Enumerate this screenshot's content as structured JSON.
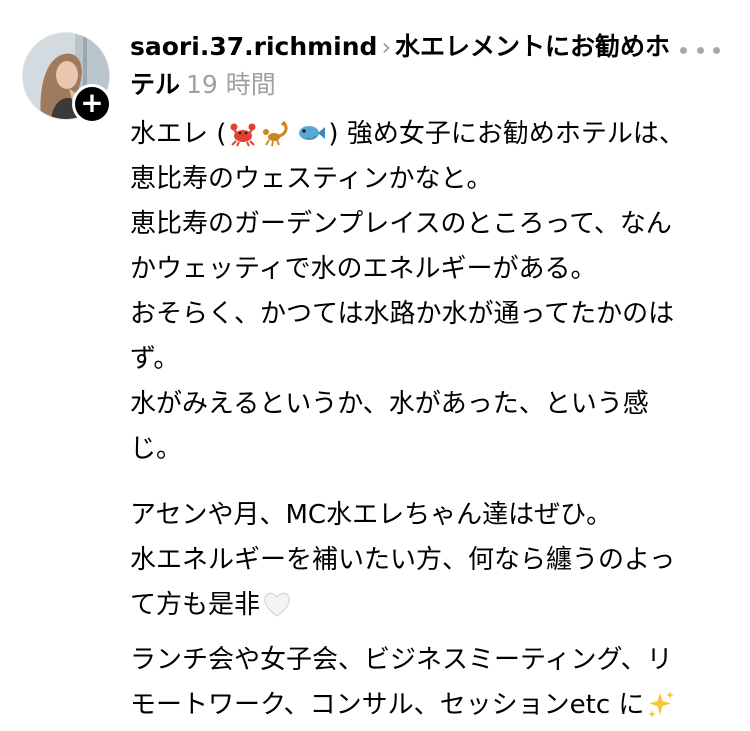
{
  "post": {
    "username": "saori.37.richmind",
    "topic": "水エレメントにお勧めホテル",
    "time": "19 時間",
    "body": {
      "line1_pre": "水エレ (",
      "line1_post": ") 強め女子にお勧めホテルは、",
      "line2": "恵比寿のウェスティンかなと。",
      "line3": "恵比寿のガーデンプレイスのところって、なん",
      "line4": "かウェッティで水のエネルギーがある。",
      "line5": "おそらく、かつては水路か水が通ってたかのは",
      "line6": "ず。",
      "line7": "水がみえるというか、水があった、という感",
      "line8": "じ。",
      "line9": "アセンや月、MC水エレちゃん達はぜひ。",
      "line10": "水エネルギーを補いたい方、何なら纏うのよっ",
      "line11_pre": "て方も是非",
      "line12": "ランチ会や女子会、ビジネスミーティング、リ",
      "line13_pre": "モートワーク、コンサル、セッションetc に"
    },
    "icons": {
      "follow": "plus-icon",
      "more": "more-options-icon",
      "crab": "crab-emoji",
      "scorpion": "scorpion-emoji",
      "fish": "fish-emoji",
      "heart": "white-heart-emoji",
      "sparkles": "sparkles-emoji"
    },
    "colors": {
      "text": "#000000",
      "secondary": "#a0a0a0",
      "chevron": "#9b9b9b"
    }
  }
}
